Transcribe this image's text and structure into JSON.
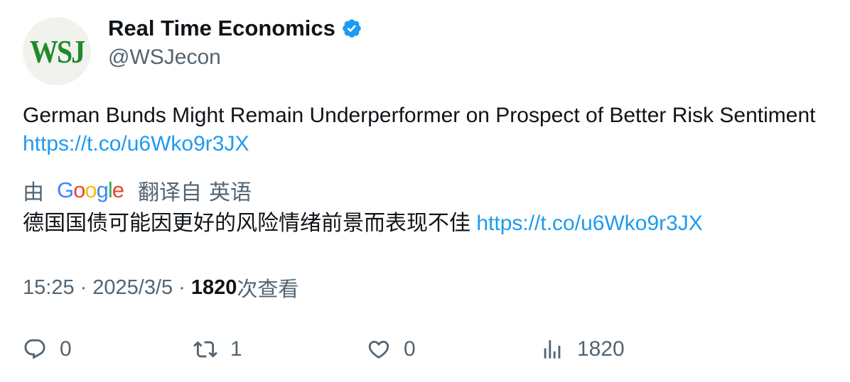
{
  "author": {
    "avatar_text": "WSJ",
    "display_name": "Real Time Economics",
    "handle": "@WSJecon",
    "verified_color": "#1d9bf0"
  },
  "tweet": {
    "text": "German Bunds Might Remain Underperformer on Prospect of Better Risk Sentiment",
    "link": "https://t.co/u6Wko9r3JX"
  },
  "translation": {
    "by_label": "由",
    "provider": "Google",
    "translated_from": "翻译自",
    "language": "英语",
    "text": "德国国债可能因更好的风险情绪前景而表现不佳",
    "link": "https://t.co/u6Wko9r3JX"
  },
  "meta": {
    "time": "15:25",
    "separator": "·",
    "date": "2025/3/5",
    "views_count": "1820",
    "views_label": "次查看"
  },
  "actions": {
    "replies": "0",
    "retweets": "1",
    "likes": "0",
    "views": "1820"
  },
  "colors": {
    "link": "#1d9bf0",
    "secondary_text": "#536471",
    "primary_text": "#0f1419",
    "google_blue": "#4285f4",
    "google_red": "#ea4335",
    "google_yellow": "#fbbc05",
    "google_green": "#34a853"
  }
}
